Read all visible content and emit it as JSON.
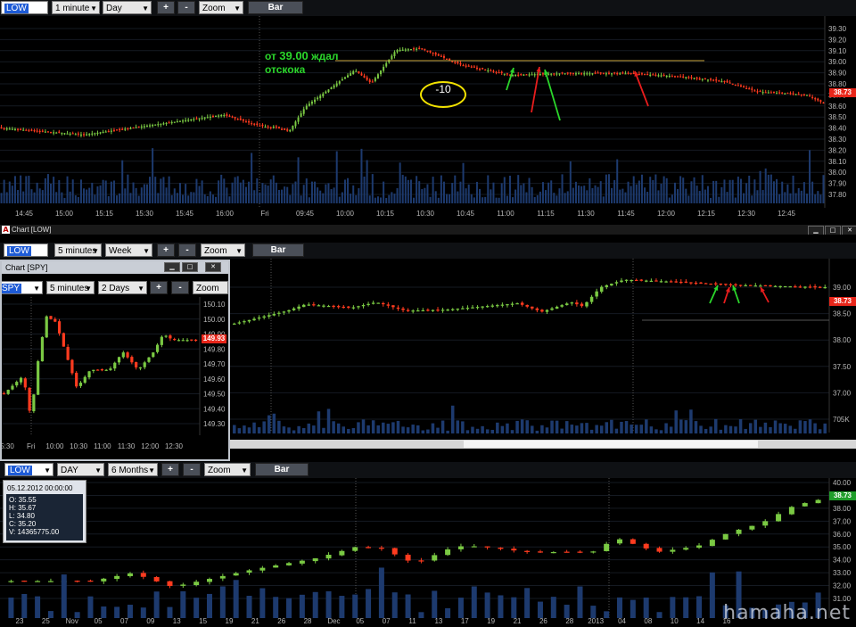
{
  "top": {
    "symbol": "LOW",
    "interval": "1 minute",
    "range": "Day",
    "plus": "+",
    "minus": "-",
    "zoom": "Zoom",
    "type": "Bar",
    "annotation_line1_prefix": "от ",
    "annotation_line1_price": "39.00",
    "annotation_line1_suffix": " ждал",
    "annotation_line2": "отскока",
    "circle_label": "-10",
    "price_tag": "38.73",
    "y_ticks": [
      "39.30",
      "39.20",
      "39.10",
      "39.00",
      "38.90",
      "38.80",
      "38.70",
      "38.60",
      "38.50",
      "38.40",
      "38.30",
      "38.20",
      "38.10",
      "38.00",
      "37.90",
      "37.80"
    ],
    "x_ticks": [
      "14:45",
      "15:00",
      "15:15",
      "15:30",
      "15:45",
      "16:00",
      "Fri",
      "09:45",
      "10:00",
      "10:15",
      "10:30",
      "10:45",
      "11:00",
      "11:15",
      "11:30",
      "11:45",
      "12:00",
      "12:15",
      "12:30",
      "12:45"
    ]
  },
  "middle": {
    "window_title": "Chart [LOW]",
    "symbol": "LOW",
    "interval": "5 minutes",
    "range": "Week",
    "plus": "+",
    "minus": "-",
    "zoom": "Zoom",
    "type": "Bar",
    "price_tag": "38.73",
    "y_ticks": [
      "39.00",
      "38.50",
      "38.00",
      "37.50",
      "37.00",
      "705K"
    ]
  },
  "spy": {
    "window_title": "Chart [SPY]",
    "symbol": "SPY",
    "interval": "5 minutes",
    "range": "2 Days",
    "plus": "+",
    "minus": "-",
    "zoom": "Zoom",
    "price_tag": "149.93",
    "y_ticks": [
      "150.10",
      "150.00",
      "149.90",
      "149.80",
      "149.70",
      "149.60",
      "149.50",
      "149.40",
      "149.30"
    ],
    "x_ticks": [
      "5:30",
      "Fri",
      "10:00",
      "10:30",
      "11:00",
      "11:30",
      "12:00",
      "12:30"
    ]
  },
  "bottom": {
    "symbol": "LOW",
    "interval": "DAY",
    "range": "6 Months",
    "plus": "+",
    "minus": "-",
    "zoom": "Zoom",
    "type": "Bar",
    "price_tag": "38.73",
    "tooltip": {
      "date": "05.12.2012 00:00:00",
      "o": "O: 35.55",
      "h": "H: 35.67",
      "l": "L: 34.80",
      "c": "C: 35.20",
      "v": "V: 14365775.00"
    },
    "y_ticks": [
      "40.00",
      "39.00",
      "38.00",
      "37.00",
      "36.00",
      "35.00",
      "34.00",
      "33.00",
      "32.00",
      "31.00"
    ],
    "x_ticks": [
      "23",
      "25",
      "Nov",
      "05",
      "07",
      "09",
      "13",
      "15",
      "19",
      "21",
      "26",
      "28",
      "Dec",
      "05",
      "07",
      "11",
      "13",
      "17",
      "19",
      "21",
      "26",
      "28",
      "2013",
      "04",
      "08",
      "10",
      "14",
      "16"
    ]
  },
  "watermark": "hamaha.net",
  "colors": {
    "up": "#7ac943",
    "down": "#ff3b1f",
    "volume": "#1d3a6e",
    "price_tag": "#e8261a",
    "price_tag_green": "#1f9e2a"
  }
}
